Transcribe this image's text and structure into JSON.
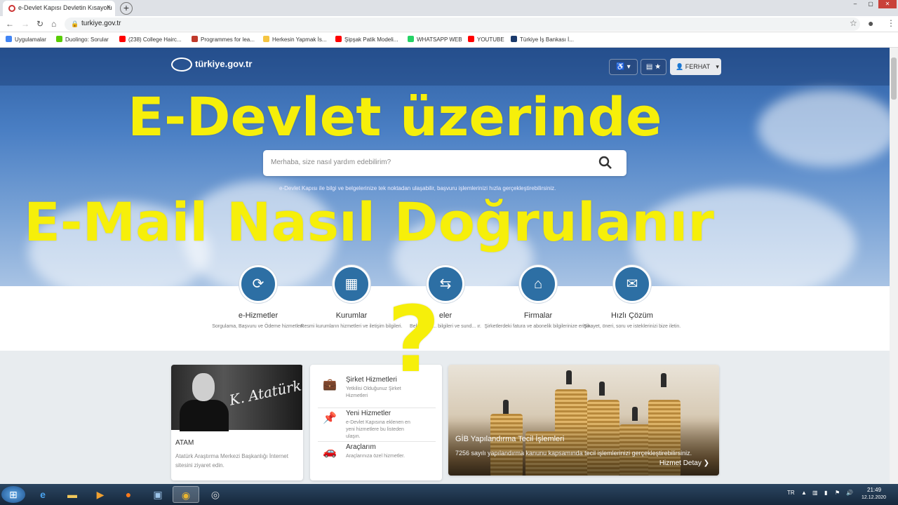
{
  "browser": {
    "tab_title": "e-Devlet Kapısı Devletin Kısayolu",
    "tab_close": "×",
    "new_tab": "+",
    "url": "turkiye.gov.tr",
    "window_controls": [
      "–",
      "▢",
      "✕"
    ],
    "bookmarks": [
      {
        "label": "Uygulamalar",
        "color": "#4285f4"
      },
      {
        "label": "Duolingo: Sorular",
        "color": "#58cc02"
      },
      {
        "label": "(238) College Hairc...",
        "color": "#ff0000"
      },
      {
        "label": "Programmes for lea...",
        "color": "#c0392b"
      },
      {
        "label": "Herkesin Yapmak İs...",
        "color": "#f5c542"
      },
      {
        "label": "Şipşak Patik Modeli...",
        "color": "#ff0000"
      },
      {
        "label": "WHATSAPP WEB",
        "color": "#25d366"
      },
      {
        "label": "YOUTUBE",
        "color": "#ff0000"
      },
      {
        "label": "Türkiye İş Bankası İ...",
        "color": "#1a3a6c"
      }
    ]
  },
  "site": {
    "logo": "türkiye.gov.tr",
    "accessibility_icon": "♿",
    "user_label": "FERHAT",
    "search_placeholder": "Merhaba, size nasıl yardım edebilirim?",
    "tagline": "e-Devlet Kapısı ile bilgi ve belgelerinize tek noktadan ulaşabilir, başvuru işlemlerinizi hızla gerçekleştirebilirsiniz."
  },
  "overlay": {
    "line1": "E-Devlet üzerinde",
    "line2": "E-Mail Nasıl  Doğrulanır",
    "question": "?"
  },
  "services": [
    {
      "title": "e-Hizmetler",
      "desc": "Sorgulama, Başvuru ve Ödeme hizmetleri.",
      "icon": "⟳"
    },
    {
      "title": "Kurumlar",
      "desc": "Resmi kurumların hizmetleri ve iletişim bilgileri.",
      "icon": "▦"
    },
    {
      "title": "eler",
      "desc": "Belediyele... bilgileri ve sund... ır.",
      "icon": "⇆"
    },
    {
      "title": "Firmalar",
      "desc": "Şirketlerdeki fatura ve abonelik bilgilerinize erişin.",
      "icon": "⌂"
    },
    {
      "title": "Hızlı Çözüm",
      "desc": "Şikayet, öneri, soru ve isteklerinizi bize iletin.",
      "icon": "✉"
    }
  ],
  "ataturk": {
    "signature": "K. Atatürk",
    "title": "ATAM",
    "desc": "Atatürk Araştırma Merkezi Başkanlığı İnternet sitesini ziyaret edin."
  },
  "quick_list": [
    {
      "title": "Şirket Hizmetleri",
      "desc": "Yetkilisi Olduğunuz Şirket Hizmetleri",
      "icon": "💼"
    },
    {
      "title": "Yeni Hizmetler",
      "desc": "e-Devlet Kapısına eklenen en yeni hizmetlere bu listeden ulaşın.",
      "icon": "📌"
    },
    {
      "title": "Araçlarım",
      "desc": "Araçlarınıza özel hizmetler.",
      "icon": "🚗"
    }
  ],
  "gib": {
    "title": "GİB Yapılandırma Tecil İşlemleri",
    "desc": "7256 sayılı yapılandırma kanunu kapsamında tecil işlemlerinizi gerçekleştirebilirsiniz.",
    "link": "Hizmet Detay"
  },
  "taskbar": {
    "lang": "TR",
    "time": "21:49",
    "date": "12.12.2020"
  }
}
